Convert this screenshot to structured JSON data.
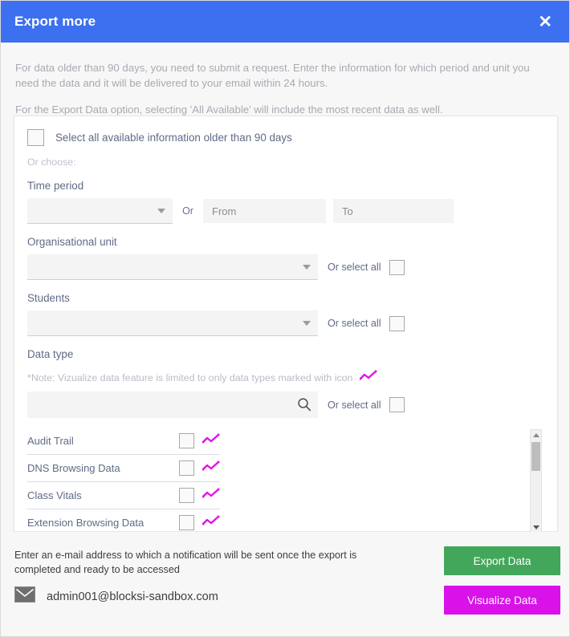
{
  "header": {
    "title": "Export more",
    "close_label": "✕"
  },
  "intro": {
    "paragraph1": "For data older than 90 days, you need to submit a request. Enter the information for which period and unit you need the data and it will be delivered to your email within 24 hours.",
    "paragraph2": "For the Export Data option, selecting 'All Available' will include the most recent data as well."
  },
  "form": {
    "select_all_older_label": "Select all available information older than 90 days",
    "or_choose_label": "Or choose:",
    "time_period_label": "Time period",
    "time_period_value": "",
    "or_label": "Or",
    "from_placeholder": "From",
    "from_value": "",
    "to_placeholder": "To",
    "to_value": "",
    "org_unit_label": "Organisational unit",
    "org_unit_value": "",
    "org_unit_select_all_label": "Or select all",
    "students_label": "Students",
    "students_value": "",
    "students_select_all_label": "Or select all",
    "data_type_label": "Data type",
    "data_type_note": "*Note: Vizualize data feature is limited to only data types marked with icon",
    "data_type_search_value": "",
    "data_type_search_placeholder": "",
    "data_type_select_all_label": "Or select all"
  },
  "data_types": [
    {
      "name": "Audit Trail",
      "checked": false,
      "has_chart_icon": true
    },
    {
      "name": "DNS Browsing Data",
      "checked": false,
      "has_chart_icon": true
    },
    {
      "name": "Class Vitals",
      "checked": false,
      "has_chart_icon": true
    },
    {
      "name": "Extension Browsing Data",
      "checked": false,
      "has_chart_icon": true
    }
  ],
  "footer": {
    "notice": "Enter an e-mail address to which a notification will be sent once the export is completed and ready to be accessed",
    "email": "admin001@blocksi-sandbox.com",
    "export_button": "Export Data",
    "visualize_button": "Visualize Data"
  },
  "colors": {
    "header_blue": "#3d70f0",
    "export_green": "#42a75a",
    "visualize_magenta": "#d812e8",
    "chart_icon_magenta": "#e312ea",
    "body_gray": "#f7f7f7"
  }
}
